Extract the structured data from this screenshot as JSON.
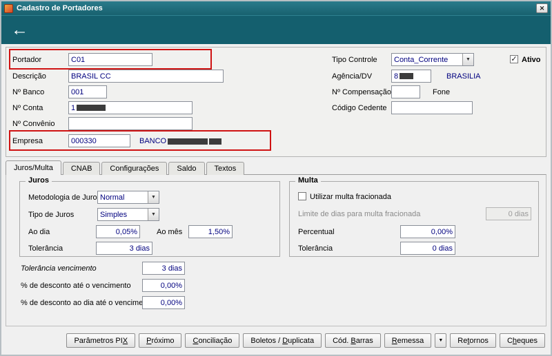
{
  "colors": {
    "titlebar_teal": "#1c6a79",
    "band_teal": "#145f6e",
    "annotation_red": "#cf1212",
    "value_navy": "#00007f",
    "window_bg": "#f0f0f0"
  },
  "icons": {
    "close": "✕",
    "back_arrow": "←",
    "dropdown_arrow": "▼",
    "check": "✓"
  },
  "window": {
    "title": "Cadastro de Portadores"
  },
  "form": {
    "portador": {
      "label": "Portador",
      "value": "C01"
    },
    "descricao": {
      "label": "Descrição",
      "value": "BRASIL CC"
    },
    "banco": {
      "label": "Nº Banco",
      "value": "001"
    },
    "conta": {
      "label": "Nº Conta",
      "value_prefix": "1"
    },
    "convenio": {
      "label": "Nº Convênio",
      "value": ""
    },
    "empresa": {
      "label": "Empresa",
      "value": "000330",
      "bank_prefix": "BANCO"
    },
    "tipo_controle": {
      "label": "Tipo Controle",
      "value": "Conta_Corrente"
    },
    "agencia": {
      "label": "Agência/DV",
      "value_prefix": "8",
      "city": "BRASILIA"
    },
    "compensacao": {
      "label": "Nº Compensação",
      "value": "",
      "fone_label": "Fone"
    },
    "cedente": {
      "label": "Código Cedente",
      "value": ""
    },
    "ativo": {
      "label": "Ativo",
      "checked": true
    }
  },
  "tabs": [
    {
      "label": "Juros/Multa",
      "active": true
    },
    {
      "label": "CNAB",
      "active": false
    },
    {
      "label": "Configurações",
      "active": false
    },
    {
      "label": "Saldo",
      "active": false
    },
    {
      "label": "Textos",
      "active": false
    }
  ],
  "juros": {
    "title": "Juros",
    "metodologia": {
      "label": "Metodologia de Juros",
      "value": "Normal"
    },
    "tipo": {
      "label": "Tipo de Juros",
      "value": "Simples"
    },
    "ao_dia": {
      "label": "Ao dia",
      "value": "0,05%"
    },
    "ao_mes": {
      "label": "Ao mês",
      "value": "1,50%"
    },
    "tolerancia": {
      "label": "Tolerância",
      "value": "3 dias"
    }
  },
  "multa": {
    "title": "Multa",
    "fracionada": {
      "label": "Utilizar multa fracionada",
      "checked": false
    },
    "limite": {
      "label": "Limite de dias para multa fracionada",
      "value": "0 dias",
      "disabled": true
    },
    "percentual": {
      "label": "Percentual",
      "value": "0,00%"
    },
    "tolerancia": {
      "label": "Tolerância",
      "value": "0 dias"
    }
  },
  "extras": {
    "tolerancia_venc": {
      "label": "Tolerância vencimento",
      "value": "3 dias"
    },
    "desc_ate": {
      "label": "% de desconto até o vencimento",
      "value": "0,00%"
    },
    "desc_dia": {
      "label": "% de desconto ao dia até o vencimento",
      "value": "0,00%"
    }
  },
  "buttons": [
    {
      "label": "Parâmetros PIX",
      "underline": 13
    },
    {
      "label": "Próximo",
      "underline": 0
    },
    {
      "label": "Conciliação",
      "underline": 0
    },
    {
      "label": "Boletos / Duplicata",
      "underline": 10
    },
    {
      "label": "Cód. Barras",
      "underline": 5
    },
    {
      "label": "Remessa",
      "underline": 0,
      "dropdown": true
    },
    {
      "label": "Retornos",
      "underline": 2
    },
    {
      "label": "Cheques",
      "underline": 1
    }
  ]
}
